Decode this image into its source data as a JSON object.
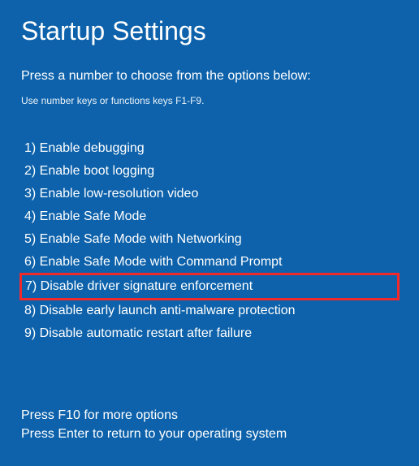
{
  "title": "Startup Settings",
  "instruction_primary": "Press a number to choose from the options below:",
  "instruction_secondary": "Use number keys or functions keys F1-F9.",
  "options": {
    "0": "1) Enable debugging",
    "1": "2) Enable boot logging",
    "2": "3) Enable low-resolution video",
    "3": "4) Enable Safe Mode",
    "4": "5) Enable Safe Mode with Networking",
    "5": "6) Enable Safe Mode with Command Prompt",
    "6": "7) Disable driver signature enforcement",
    "7": "8) Disable early launch anti-malware protection",
    "8": "9) Disable automatic restart after failure"
  },
  "footer": {
    "line1": "Press F10 for more options",
    "line2": "Press Enter to return to your operating system"
  },
  "highlighted_index": 6,
  "colors": {
    "background": "#0d62ab",
    "text": "#ffffff",
    "highlight_border": "#f2292a"
  }
}
